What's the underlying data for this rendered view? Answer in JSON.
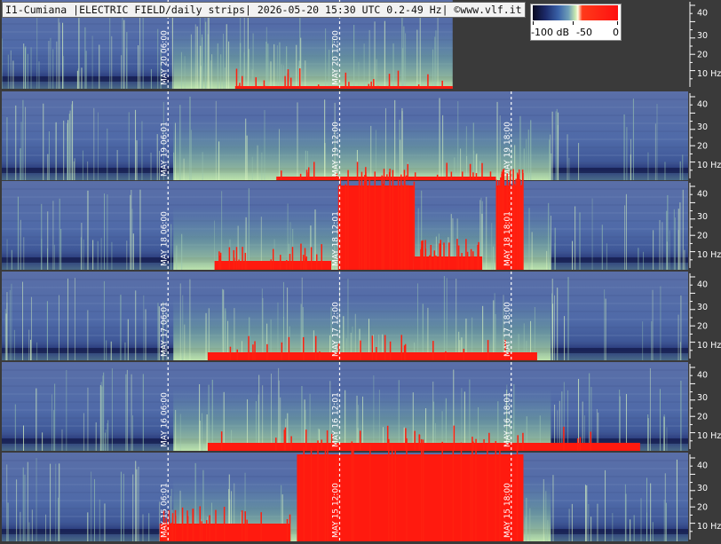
{
  "header": {
    "title": "I1-Cumiana |ELECTRIC FIELD/daily strips| 2026-05-20 15:30 UTC 0.2-49 Hz| ©www.vlf.it"
  },
  "colorbar": {
    "labels": [
      "-100 dB",
      "-50",
      "0"
    ],
    "colors": [
      "#0a0a20",
      "#3a62a8",
      "#c8e8b0",
      "#ff1010"
    ]
  },
  "chart_data": {
    "type": "heatmap",
    "title": "I1-Cumiana |ELECTRIC FIELD/daily strips| 2026-05-20 15:30 UTC 0.2-49 Hz| ©www.vlf.it",
    "y_ticks": [
      "40",
      "30",
      "20",
      "10 Hz"
    ],
    "y_range_hz": [
      0.2,
      49
    ],
    "color_range_db": [
      -100,
      0
    ],
    "strips": [
      {
        "day": "MAY 20",
        "time_labels": [
          "MAY 20 06:00",
          "MAY 20 12:00"
        ],
        "data_end_utc": "15:30",
        "red_bursts": [
          [
            0.34,
            0.98,
            0.03
          ]
        ]
      },
      {
        "day": "MAY 19",
        "time_labels": [
          "MAY 19 06:01",
          "MAY 19 12:00",
          "MAY 19 18:00"
        ],
        "red_bursts": [
          [
            0.4,
            0.72,
            0.04
          ]
        ]
      },
      {
        "day": "MAY 18",
        "time_labels": [
          "MAY 18 06:00",
          "MAY 18 12:01",
          "MAY 18 18:01"
        ],
        "red_bursts": [
          [
            0.31,
            0.48,
            0.1
          ],
          [
            0.49,
            0.6,
            0.95
          ],
          [
            0.6,
            0.7,
            0.15
          ],
          [
            0.72,
            0.76,
            0.95
          ]
        ]
      },
      {
        "day": "MAY 17",
        "time_labels": [
          "MAY 17 06:01",
          "MAY 17 12:00",
          "MAY 17 18:00"
        ],
        "red_bursts": [
          [
            0.3,
            0.78,
            0.09
          ]
        ]
      },
      {
        "day": "MAY 16",
        "time_labels": [
          "MAY 16 06:00",
          "MAY 16 12:01",
          "MAY 16 18:01"
        ],
        "red_bursts": [
          [
            0.3,
            0.93,
            0.09
          ]
        ]
      },
      {
        "day": "MAY 15",
        "time_labels": [
          "MAY 15 06:01",
          "MAY 15 12:00",
          "MAY 15 18:00"
        ],
        "red_bursts": [
          [
            0.23,
            0.42,
            0.2
          ],
          [
            0.43,
            0.76,
            0.98
          ]
        ]
      }
    ]
  }
}
